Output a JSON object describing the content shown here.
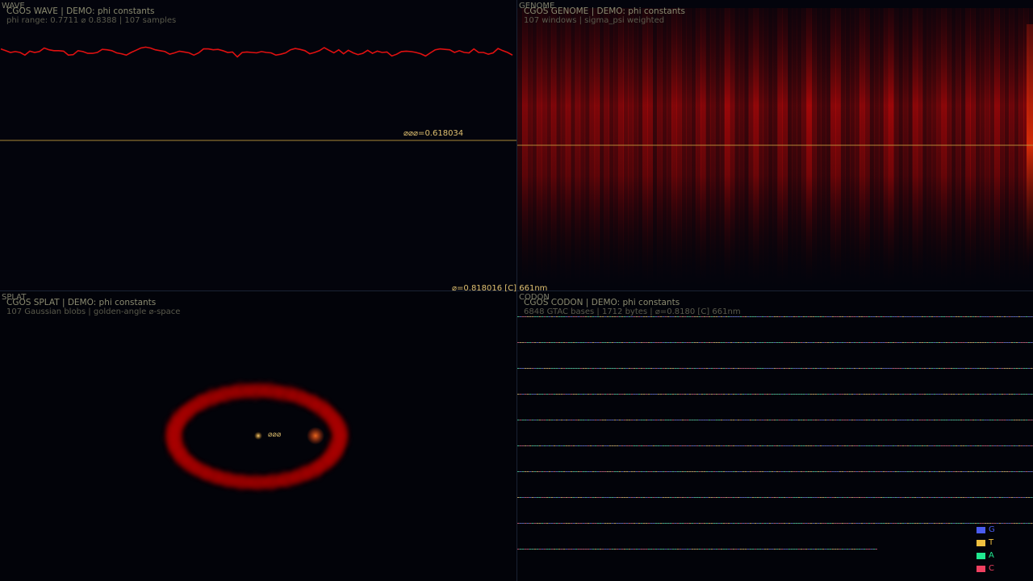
{
  "panels": {
    "wave": {
      "tag": "WAVE",
      "header": "CGOS WAVE  |  DEMO: phi constants",
      "subheader": "phi range: 0.7711 ⌀ 0.8388  |  107 samples",
      "ref_label": "⌀⌀⌀=0.618034"
    },
    "genome": {
      "tag": "GENOME",
      "header": "CGOS GENOME  |  DEMO: phi constants",
      "subheader": "107 windows  |  sigma_psi weighted"
    },
    "splat": {
      "tag": "SPLAT",
      "header": "CGOS SPLAT  |  DEMO: phi constants",
      "subheader": "107 Gaussian blobs  |  golden-angle ⌀-space",
      "center_label": "⌀⌀⌀"
    },
    "codon": {
      "tag": "CODON",
      "header": "CGOS CODON  |  DEMO: phi constants",
      "subheader": "6848 GTAC bases  |  1712 bytes  |  ⌀=0.8180 [C] 661nm",
      "legend": [
        {
          "base": "G",
          "color": "#4a5cf0"
        },
        {
          "base": "T",
          "color": "#f0c040"
        },
        {
          "base": "A",
          "color": "#20e890"
        },
        {
          "base": "C",
          "color": "#f04060"
        }
      ]
    }
  },
  "status_readout": "⌀=0.818016 [C] 661nm",
  "colors": {
    "accent_red": "#e01010",
    "gold_line": "#c8a040",
    "background": "#03040c"
  },
  "chart_data": [
    {
      "type": "line",
      "title": "CGOS WAVE",
      "sample_count": 107,
      "ylim": [
        0.7711,
        0.8388
      ],
      "reference_line": 0.618034,
      "y_values": [
        0.834,
        0.83,
        0.826,
        0.828,
        0.826,
        0.82,
        0.829,
        0.826,
        0.828,
        0.836,
        0.832,
        0.83,
        0.83,
        0.829,
        0.82,
        0.821,
        0.83,
        0.828,
        0.824,
        0.824,
        0.826,
        0.833,
        0.832,
        0.83,
        0.825,
        0.823,
        0.82,
        0.826,
        0.831,
        0.836,
        0.838,
        0.836,
        0.832,
        0.83,
        0.828,
        0.822,
        0.825,
        0.829,
        0.827,
        0.825,
        0.82,
        0.825,
        0.834,
        0.834,
        0.832,
        0.833,
        0.83,
        0.826,
        0.827,
        0.816,
        0.826,
        0.827,
        0.826,
        0.825,
        0.828,
        0.826,
        0.825,
        0.82,
        0.822,
        0.825,
        0.832,
        0.835,
        0.833,
        0.83,
        0.823,
        0.826,
        0.83,
        0.837,
        0.831,
        0.825,
        0.832,
        0.823,
        0.831,
        0.825,
        0.821,
        0.824,
        0.831,
        0.824,
        0.829,
        0.826,
        0.827,
        0.818,
        0.822,
        0.828,
        0.829,
        0.828,
        0.826,
        0.823,
        0.818,
        0.825,
        0.832,
        0.834,
        0.833,
        0.832,
        0.826,
        0.83,
        0.826,
        0.825,
        0.834,
        0.826,
        0.826,
        0.822,
        0.825,
        0.835,
        0.83,
        0.826,
        0.82
      ]
    }
  ]
}
